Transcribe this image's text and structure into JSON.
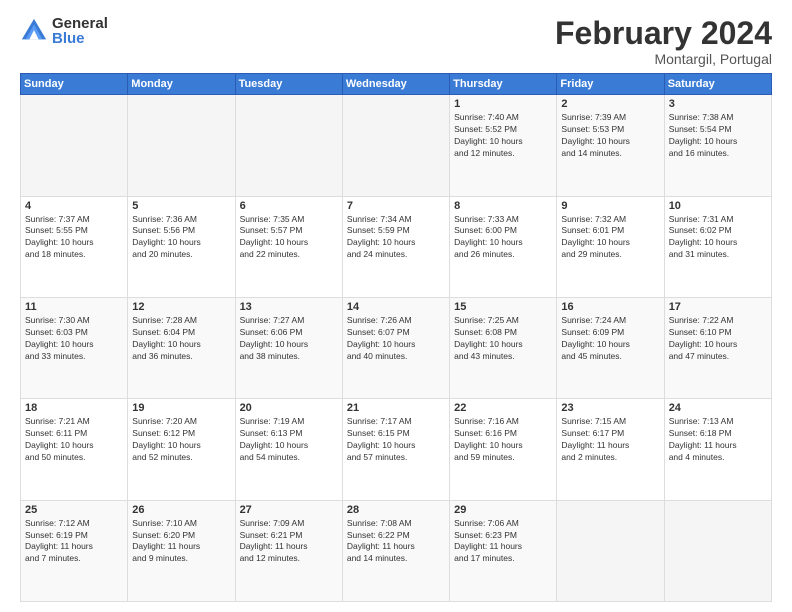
{
  "logo": {
    "general": "General",
    "blue": "Blue"
  },
  "title": "February 2024",
  "location": "Montargil, Portugal",
  "days_of_week": [
    "Sunday",
    "Monday",
    "Tuesday",
    "Wednesday",
    "Thursday",
    "Friday",
    "Saturday"
  ],
  "weeks": [
    [
      {
        "day": "",
        "info": ""
      },
      {
        "day": "",
        "info": ""
      },
      {
        "day": "",
        "info": ""
      },
      {
        "day": "",
        "info": ""
      },
      {
        "day": "1",
        "info": "Sunrise: 7:40 AM\nSunset: 5:52 PM\nDaylight: 10 hours\nand 12 minutes."
      },
      {
        "day": "2",
        "info": "Sunrise: 7:39 AM\nSunset: 5:53 PM\nDaylight: 10 hours\nand 14 minutes."
      },
      {
        "day": "3",
        "info": "Sunrise: 7:38 AM\nSunset: 5:54 PM\nDaylight: 10 hours\nand 16 minutes."
      }
    ],
    [
      {
        "day": "4",
        "info": "Sunrise: 7:37 AM\nSunset: 5:55 PM\nDaylight: 10 hours\nand 18 minutes."
      },
      {
        "day": "5",
        "info": "Sunrise: 7:36 AM\nSunset: 5:56 PM\nDaylight: 10 hours\nand 20 minutes."
      },
      {
        "day": "6",
        "info": "Sunrise: 7:35 AM\nSunset: 5:57 PM\nDaylight: 10 hours\nand 22 minutes."
      },
      {
        "day": "7",
        "info": "Sunrise: 7:34 AM\nSunset: 5:59 PM\nDaylight: 10 hours\nand 24 minutes."
      },
      {
        "day": "8",
        "info": "Sunrise: 7:33 AM\nSunset: 6:00 PM\nDaylight: 10 hours\nand 26 minutes."
      },
      {
        "day": "9",
        "info": "Sunrise: 7:32 AM\nSunset: 6:01 PM\nDaylight: 10 hours\nand 29 minutes."
      },
      {
        "day": "10",
        "info": "Sunrise: 7:31 AM\nSunset: 6:02 PM\nDaylight: 10 hours\nand 31 minutes."
      }
    ],
    [
      {
        "day": "11",
        "info": "Sunrise: 7:30 AM\nSunset: 6:03 PM\nDaylight: 10 hours\nand 33 minutes."
      },
      {
        "day": "12",
        "info": "Sunrise: 7:28 AM\nSunset: 6:04 PM\nDaylight: 10 hours\nand 36 minutes."
      },
      {
        "day": "13",
        "info": "Sunrise: 7:27 AM\nSunset: 6:06 PM\nDaylight: 10 hours\nand 38 minutes."
      },
      {
        "day": "14",
        "info": "Sunrise: 7:26 AM\nSunset: 6:07 PM\nDaylight: 10 hours\nand 40 minutes."
      },
      {
        "day": "15",
        "info": "Sunrise: 7:25 AM\nSunset: 6:08 PM\nDaylight: 10 hours\nand 43 minutes."
      },
      {
        "day": "16",
        "info": "Sunrise: 7:24 AM\nSunset: 6:09 PM\nDaylight: 10 hours\nand 45 minutes."
      },
      {
        "day": "17",
        "info": "Sunrise: 7:22 AM\nSunset: 6:10 PM\nDaylight: 10 hours\nand 47 minutes."
      }
    ],
    [
      {
        "day": "18",
        "info": "Sunrise: 7:21 AM\nSunset: 6:11 PM\nDaylight: 10 hours\nand 50 minutes."
      },
      {
        "day": "19",
        "info": "Sunrise: 7:20 AM\nSunset: 6:12 PM\nDaylight: 10 hours\nand 52 minutes."
      },
      {
        "day": "20",
        "info": "Sunrise: 7:19 AM\nSunset: 6:13 PM\nDaylight: 10 hours\nand 54 minutes."
      },
      {
        "day": "21",
        "info": "Sunrise: 7:17 AM\nSunset: 6:15 PM\nDaylight: 10 hours\nand 57 minutes."
      },
      {
        "day": "22",
        "info": "Sunrise: 7:16 AM\nSunset: 6:16 PM\nDaylight: 10 hours\nand 59 minutes."
      },
      {
        "day": "23",
        "info": "Sunrise: 7:15 AM\nSunset: 6:17 PM\nDaylight: 11 hours\nand 2 minutes."
      },
      {
        "day": "24",
        "info": "Sunrise: 7:13 AM\nSunset: 6:18 PM\nDaylight: 11 hours\nand 4 minutes."
      }
    ],
    [
      {
        "day": "25",
        "info": "Sunrise: 7:12 AM\nSunset: 6:19 PM\nDaylight: 11 hours\nand 7 minutes."
      },
      {
        "day": "26",
        "info": "Sunrise: 7:10 AM\nSunset: 6:20 PM\nDaylight: 11 hours\nand 9 minutes."
      },
      {
        "day": "27",
        "info": "Sunrise: 7:09 AM\nSunset: 6:21 PM\nDaylight: 11 hours\nand 12 minutes."
      },
      {
        "day": "28",
        "info": "Sunrise: 7:08 AM\nSunset: 6:22 PM\nDaylight: 11 hours\nand 14 minutes."
      },
      {
        "day": "29",
        "info": "Sunrise: 7:06 AM\nSunset: 6:23 PM\nDaylight: 11 hours\nand 17 minutes."
      },
      {
        "day": "",
        "info": ""
      },
      {
        "day": "",
        "info": ""
      }
    ]
  ]
}
